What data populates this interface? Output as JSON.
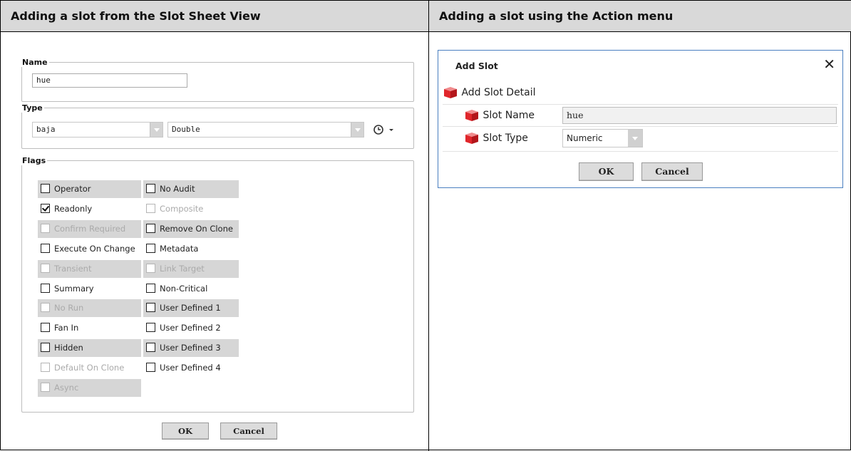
{
  "headers": {
    "left": "Adding a slot from the Slot Sheet View",
    "right": "Adding a slot using the Action menu"
  },
  "slot_sheet": {
    "name_legend": "Name",
    "name_value": "hue",
    "type_legend": "Type",
    "type_module": "baja",
    "type_value": "Double",
    "flags_legend": "Flags",
    "flags_col1": [
      {
        "label": "Operator",
        "checked": false,
        "enabled": true
      },
      {
        "label": "Readonly",
        "checked": true,
        "enabled": true
      },
      {
        "label": "Confirm Required",
        "checked": false,
        "enabled": false
      },
      {
        "label": "Execute On Change",
        "checked": false,
        "enabled": true
      },
      {
        "label": "Transient",
        "checked": false,
        "enabled": false
      },
      {
        "label": "Summary",
        "checked": false,
        "enabled": true
      },
      {
        "label": "No Run",
        "checked": false,
        "enabled": false
      },
      {
        "label": "Fan In",
        "checked": false,
        "enabled": true
      },
      {
        "label": "Hidden",
        "checked": false,
        "enabled": true
      },
      {
        "label": "Default On Clone",
        "checked": false,
        "enabled": false
      },
      {
        "label": "Async",
        "checked": false,
        "enabled": false
      }
    ],
    "flags_col2": [
      {
        "label": "No Audit",
        "checked": false,
        "enabled": true
      },
      {
        "label": "Composite",
        "checked": false,
        "enabled": false
      },
      {
        "label": "Remove On Clone",
        "checked": false,
        "enabled": true
      },
      {
        "label": "Metadata",
        "checked": false,
        "enabled": true
      },
      {
        "label": "Link Target",
        "checked": false,
        "enabled": false
      },
      {
        "label": "Non-Critical",
        "checked": false,
        "enabled": true
      },
      {
        "label": "User Defined 1",
        "checked": false,
        "enabled": true
      },
      {
        "label": "User Defined 2",
        "checked": false,
        "enabled": true
      },
      {
        "label": "User Defined 3",
        "checked": false,
        "enabled": true
      },
      {
        "label": "User Defined 4",
        "checked": false,
        "enabled": true
      }
    ],
    "ok_label": "OK",
    "cancel_label": "Cancel"
  },
  "add_slot_dialog": {
    "title": "Add Slot",
    "close_glyph": "✕",
    "section_label": "Add Slot Detail",
    "slot_name_label": "Slot Name",
    "slot_name_value": "hue",
    "slot_type_label": "Slot Type",
    "slot_type_value": "Numeric",
    "ok_label": "OK",
    "cancel_label": "Cancel"
  },
  "icons": {
    "slot_icon": "red-cube-icon",
    "history_icon": "clock-icon"
  },
  "colors": {
    "header_bg": "#d9d9d9",
    "dialog_border": "#4a7fc0",
    "cube_red": "#e0262b"
  }
}
